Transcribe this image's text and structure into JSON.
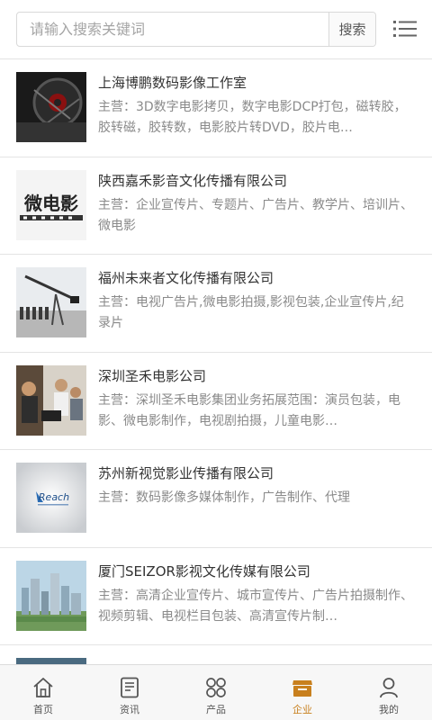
{
  "search": {
    "placeholder": "请输入搜索关键词",
    "button_label": "搜索"
  },
  "list": [
    {
      "title": "上海博鹏数码影像工作室",
      "desc": "主营：3D数字电影拷贝，数字电影DCP打包，磁转胶，胶转磁，胶转数，电影胶片转DVD，胶片电…",
      "thumb_icon": "film-reel-image"
    },
    {
      "title": "陕西嘉禾影音文化传播有限公司",
      "desc": "主营：企业宣传片、专题片、广告片、教学片、培训片、微电影",
      "thumb_icon": "micro-film-logo-image",
      "thumb_text": "微电影"
    },
    {
      "title": "福州未来者文化传播有限公司",
      "desc": "主营：电视广告片,微电影拍摄,影视包装,企业宣传片,纪录片",
      "thumb_icon": "camera-crane-image"
    },
    {
      "title": "深圳圣禾电影公司",
      "desc": "主营：深圳圣禾电影集团业务拓展范围：演员包装，电影、微电影制作，电视剧拍摄，儿童电影…",
      "thumb_icon": "film-crew-image"
    },
    {
      "title": "苏州新视觉影业传播有限公司",
      "desc": "主营：数码影像多媒体制作，广告制作、代理",
      "thumb_icon": "reach-logo-image",
      "thumb_text": "Reach"
    },
    {
      "title": "厦门SEIZOR影视文化传媒有限公司",
      "desc": "主营：高清企业宣传片、城市宣传片、广告片拍摄制作、视频剪辑、电视栏目包装、高清宣传片制…",
      "thumb_icon": "city-skyline-image"
    }
  ],
  "tabs": [
    {
      "label": "首页",
      "icon": "home-icon",
      "active": false
    },
    {
      "label": "资讯",
      "icon": "news-icon",
      "active": false
    },
    {
      "label": "产品",
      "icon": "grid-icon",
      "active": false
    },
    {
      "label": "企业",
      "icon": "shop-icon",
      "active": true
    },
    {
      "label": "我的",
      "icon": "user-icon",
      "active": false
    }
  ],
  "colors": {
    "active_tab": "#c8801e",
    "inactive_tab": "#555555"
  }
}
